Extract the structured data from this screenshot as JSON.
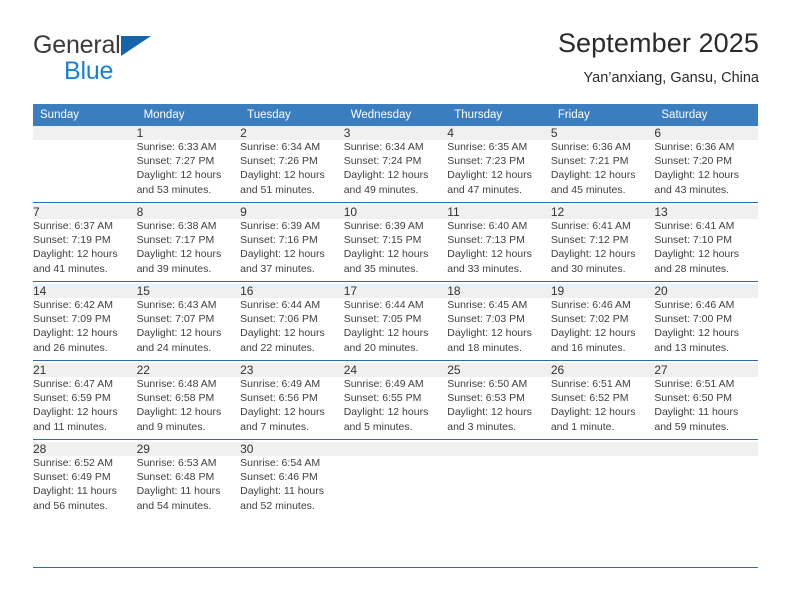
{
  "brand": {
    "name_top": "General",
    "name_bottom": "Blue",
    "triangle_color": "#1464aa",
    "blue_text_color": "#1b7fd4",
    "icon": "general-blue-triangle-logo"
  },
  "header": {
    "title": "September 2025",
    "subtitle": "Yan’anxiang, Gansu, China"
  },
  "theme": {
    "header_row_bg": "#3a7ebf",
    "header_row_text": "#ffffff",
    "daynum_band_bg": "#f0f0f0",
    "week_separator": "#2c6ca8",
    "body_text": "#404040"
  },
  "calendar": {
    "weekday_headers": [
      "Sunday",
      "Monday",
      "Tuesday",
      "Wednesday",
      "Thursday",
      "Friday",
      "Saturday"
    ],
    "weeks": [
      [
        {
          "day": "",
          "lines": []
        },
        {
          "day": "1",
          "lines": [
            "Sunrise: 6:33 AM",
            "Sunset: 7:27 PM",
            "Daylight: 12 hours",
            "and 53 minutes."
          ]
        },
        {
          "day": "2",
          "lines": [
            "Sunrise: 6:34 AM",
            "Sunset: 7:26 PM",
            "Daylight: 12 hours",
            "and 51 minutes."
          ]
        },
        {
          "day": "3",
          "lines": [
            "Sunrise: 6:34 AM",
            "Sunset: 7:24 PM",
            "Daylight: 12 hours",
            "and 49 minutes."
          ]
        },
        {
          "day": "4",
          "lines": [
            "Sunrise: 6:35 AM",
            "Sunset: 7:23 PM",
            "Daylight: 12 hours",
            "and 47 minutes."
          ]
        },
        {
          "day": "5",
          "lines": [
            "Sunrise: 6:36 AM",
            "Sunset: 7:21 PM",
            "Daylight: 12 hours",
            "and 45 minutes."
          ]
        },
        {
          "day": "6",
          "lines": [
            "Sunrise: 6:36 AM",
            "Sunset: 7:20 PM",
            "Daylight: 12 hours",
            "and 43 minutes."
          ]
        }
      ],
      [
        {
          "day": "7",
          "lines": [
            "Sunrise: 6:37 AM",
            "Sunset: 7:19 PM",
            "Daylight: 12 hours",
            "and 41 minutes."
          ]
        },
        {
          "day": "8",
          "lines": [
            "Sunrise: 6:38 AM",
            "Sunset: 7:17 PM",
            "Daylight: 12 hours",
            "and 39 minutes."
          ]
        },
        {
          "day": "9",
          "lines": [
            "Sunrise: 6:39 AM",
            "Sunset: 7:16 PM",
            "Daylight: 12 hours",
            "and 37 minutes."
          ]
        },
        {
          "day": "10",
          "lines": [
            "Sunrise: 6:39 AM",
            "Sunset: 7:15 PM",
            "Daylight: 12 hours",
            "and 35 minutes."
          ]
        },
        {
          "day": "11",
          "lines": [
            "Sunrise: 6:40 AM",
            "Sunset: 7:13 PM",
            "Daylight: 12 hours",
            "and 33 minutes."
          ]
        },
        {
          "day": "12",
          "lines": [
            "Sunrise: 6:41 AM",
            "Sunset: 7:12 PM",
            "Daylight: 12 hours",
            "and 30 minutes."
          ]
        },
        {
          "day": "13",
          "lines": [
            "Sunrise: 6:41 AM",
            "Sunset: 7:10 PM",
            "Daylight: 12 hours",
            "and 28 minutes."
          ]
        }
      ],
      [
        {
          "day": "14",
          "lines": [
            "Sunrise: 6:42 AM",
            "Sunset: 7:09 PM",
            "Daylight: 12 hours",
            "and 26 minutes."
          ]
        },
        {
          "day": "15",
          "lines": [
            "Sunrise: 6:43 AM",
            "Sunset: 7:07 PM",
            "Daylight: 12 hours",
            "and 24 minutes."
          ]
        },
        {
          "day": "16",
          "lines": [
            "Sunrise: 6:44 AM",
            "Sunset: 7:06 PM",
            "Daylight: 12 hours",
            "and 22 minutes."
          ]
        },
        {
          "day": "17",
          "lines": [
            "Sunrise: 6:44 AM",
            "Sunset: 7:05 PM",
            "Daylight: 12 hours",
            "and 20 minutes."
          ]
        },
        {
          "day": "18",
          "lines": [
            "Sunrise: 6:45 AM",
            "Sunset: 7:03 PM",
            "Daylight: 12 hours",
            "and 18 minutes."
          ]
        },
        {
          "day": "19",
          "lines": [
            "Sunrise: 6:46 AM",
            "Sunset: 7:02 PM",
            "Daylight: 12 hours",
            "and 16 minutes."
          ]
        },
        {
          "day": "20",
          "lines": [
            "Sunrise: 6:46 AM",
            "Sunset: 7:00 PM",
            "Daylight: 12 hours",
            "and 13 minutes."
          ]
        }
      ],
      [
        {
          "day": "21",
          "lines": [
            "Sunrise: 6:47 AM",
            "Sunset: 6:59 PM",
            "Daylight: 12 hours",
            "and 11 minutes."
          ]
        },
        {
          "day": "22",
          "lines": [
            "Sunrise: 6:48 AM",
            "Sunset: 6:58 PM",
            "Daylight: 12 hours",
            "and 9 minutes."
          ]
        },
        {
          "day": "23",
          "lines": [
            "Sunrise: 6:49 AM",
            "Sunset: 6:56 PM",
            "Daylight: 12 hours",
            "and 7 minutes."
          ]
        },
        {
          "day": "24",
          "lines": [
            "Sunrise: 6:49 AM",
            "Sunset: 6:55 PM",
            "Daylight: 12 hours",
            "and 5 minutes."
          ]
        },
        {
          "day": "25",
          "lines": [
            "Sunrise: 6:50 AM",
            "Sunset: 6:53 PM",
            "Daylight: 12 hours",
            "and 3 minutes."
          ]
        },
        {
          "day": "26",
          "lines": [
            "Sunrise: 6:51 AM",
            "Sunset: 6:52 PM",
            "Daylight: 12 hours",
            "and 1 minute."
          ]
        },
        {
          "day": "27",
          "lines": [
            "Sunrise: 6:51 AM",
            "Sunset: 6:50 PM",
            "Daylight: 11 hours",
            "and 59 minutes."
          ]
        }
      ],
      [
        {
          "day": "28",
          "lines": [
            "Sunrise: 6:52 AM",
            "Sunset: 6:49 PM",
            "Daylight: 11 hours",
            "and 56 minutes."
          ]
        },
        {
          "day": "29",
          "lines": [
            "Sunrise: 6:53 AM",
            "Sunset: 6:48 PM",
            "Daylight: 11 hours",
            "and 54 minutes."
          ]
        },
        {
          "day": "30",
          "lines": [
            "Sunrise: 6:54 AM",
            "Sunset: 6:46 PM",
            "Daylight: 11 hours",
            "and 52 minutes."
          ]
        },
        {
          "day": "",
          "lines": []
        },
        {
          "day": "",
          "lines": []
        },
        {
          "day": "",
          "lines": []
        },
        {
          "day": "",
          "lines": []
        }
      ]
    ]
  }
}
